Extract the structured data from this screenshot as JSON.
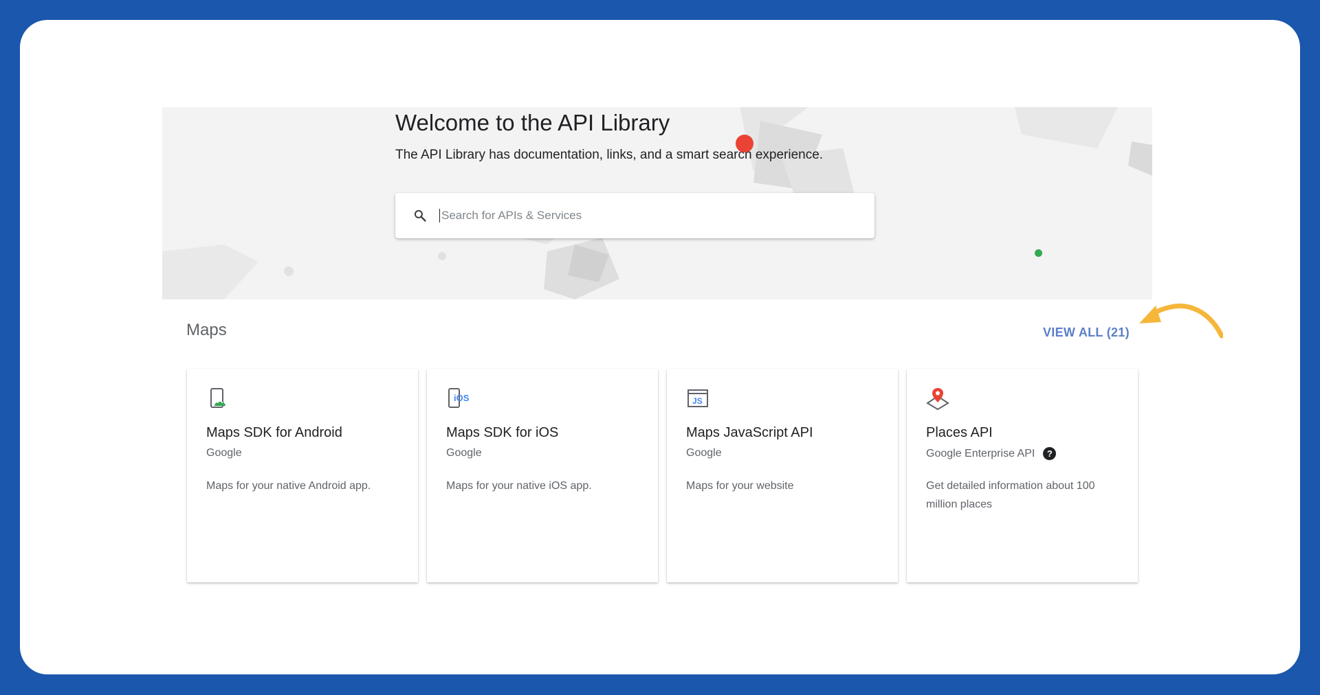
{
  "hero": {
    "title": "Welcome to the API Library",
    "subtitle": "The API Library has documentation, links, and a smart search experience."
  },
  "search": {
    "placeholder": "Search for APIs & Services",
    "icon": "search-icon"
  },
  "section": {
    "title": "Maps",
    "view_all": "VIEW ALL (21)"
  },
  "cards": [
    {
      "title": "Maps SDK for Android",
      "vendor": "Google",
      "description": "Maps for your native Android app.",
      "icon": "android-phone-icon"
    },
    {
      "title": "Maps SDK for iOS",
      "vendor": "Google",
      "description": "Maps for your native iOS app.",
      "icon": "ios-phone-icon"
    },
    {
      "title": "Maps JavaScript API",
      "vendor": "Google",
      "description": "Maps for your website",
      "icon": "javascript-icon"
    },
    {
      "title": "Places API",
      "vendor": "Google Enterprise API",
      "description": "Get detailed information about 100 million places",
      "icon": "map-pin-icon"
    }
  ],
  "colors": {
    "frame_background": "#1a57ad",
    "view_all": "#5b7fc7",
    "arrow": "#f5b63a",
    "accent_red": "#ea4335",
    "accent_green": "#34a853"
  }
}
